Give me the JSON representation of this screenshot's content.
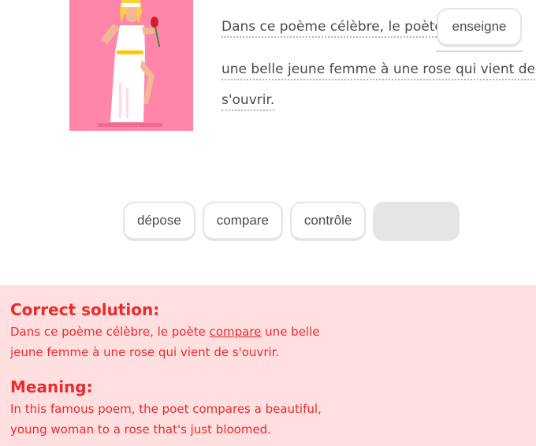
{
  "sentence": {
    "part_before": "Dans ce poème célèbre, le poète",
    "placed_word": "enseigne",
    "line2": "une belle jeune femme à une rose qui vient de",
    "line3": "s'ouvrir."
  },
  "word_bank": [
    "dépose",
    "compare",
    "contrôle"
  ],
  "feedback": {
    "solution_heading": "Correct solution:",
    "solution_before": "Dans ce poème célèbre, le poète ",
    "solution_word": "compare",
    "solution_after_line1": " une belle",
    "solution_line2": "jeune femme à une rose qui vient de s'ouvrir.",
    "meaning_heading": "Meaning:",
    "meaning_line1": "In this famous poem, the poet compares a beautiful,",
    "meaning_line2": "young woman to a rose that's just bloomed."
  },
  "colors": {
    "illustration_bg": "#ff86a8",
    "feedback_bg": "#ffdfe0",
    "feedback_text": "#ea2b2b",
    "chip_border": "#e5e5e5",
    "empty_chip": "#e5e5e5"
  },
  "icons": {
    "illustration": "woman-holding-rose-illustration"
  }
}
